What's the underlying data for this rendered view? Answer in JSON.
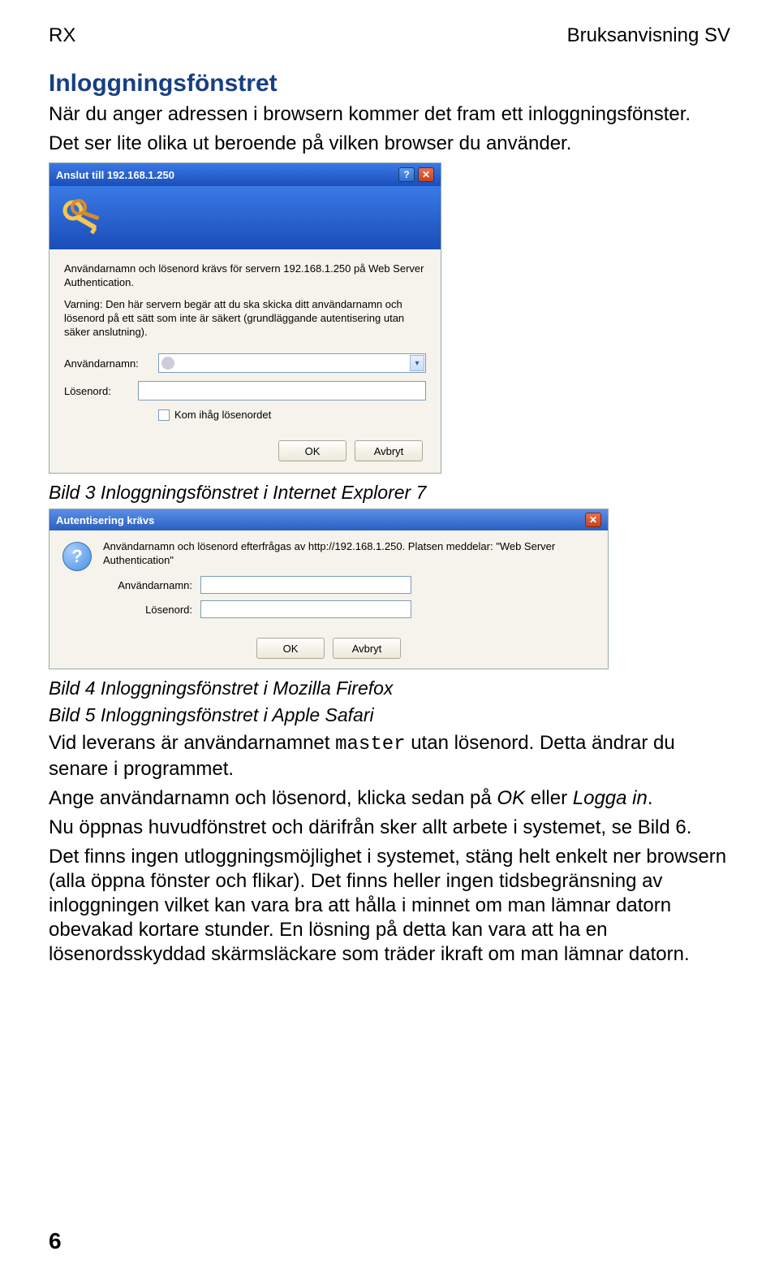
{
  "header": {
    "left": "RX",
    "right": "Bruksanvisning SV"
  },
  "section": {
    "heading": "Inloggningsfönstret"
  },
  "intro": {
    "line1": "När du anger adressen i browsern kommer det fram ett inloggningsfönster.",
    "line2": "Det ser lite olika ut beroende på vilken browser du använder."
  },
  "ie": {
    "title": "Anslut till 192.168.1.250",
    "instr": "Användarnamn och lösenord krävs för servern 192.168.1.250 på Web Server Authentication.",
    "warn": "Varning: Den här servern begär att du ska skicka ditt användarnamn och lösenord på ett sätt som inte är säkert (grundläggande autentisering utan säker anslutning).",
    "user_label": "Användarnamn:",
    "user_value": "",
    "pass_label": "Lösenord:",
    "remember": "Kom ihåg lösenordet",
    "ok": "OK",
    "cancel": "Avbryt"
  },
  "caption1": "Bild 3 Inloggningsfönstret i Internet Explorer 7",
  "ff": {
    "title": "Autentisering krävs",
    "msg": "Användarnamn och lösenord efterfrågas av http://192.168.1.250. Platsen meddelar: \"Web Server Authentication\"",
    "user_label": "Användarnamn:",
    "pass_label": "Lösenord:",
    "ok": "OK",
    "cancel": "Avbryt"
  },
  "caption2": "Bild 4 Inloggningsfönstret i Mozilla Firefox",
  "caption3": "Bild 5 Inloggningsfönstret i Apple Safari",
  "para1_a": "Vid leverans är användarnamnet ",
  "para1_m": "master",
  "para1_b": " utan lösenord. Detta ändrar du senare i programmet.",
  "para2_a": "Ange användarnamn och lösenord, klicka sedan på ",
  "para2_i1": "OK",
  "para2_b": " eller ",
  "para2_i2": "Logga in",
  "para2_c": ".",
  "para3": "Nu öppnas huvudfönstret och därifrån sker allt arbete i systemet, se Bild 6.",
  "para4": "Det finns ingen utloggningsmöjlighet i systemet, stäng helt enkelt ner browsern (alla öppna fönster och flikar). Det finns heller ingen tidsbegränsning av inloggningen vilket kan vara bra att hålla i minnet om man lämnar datorn obevakad kortare stunder. En lösning på detta kan vara att ha en lösenordsskyddad skärmsläckare som träder ikraft om man lämnar datorn.",
  "page": "6"
}
